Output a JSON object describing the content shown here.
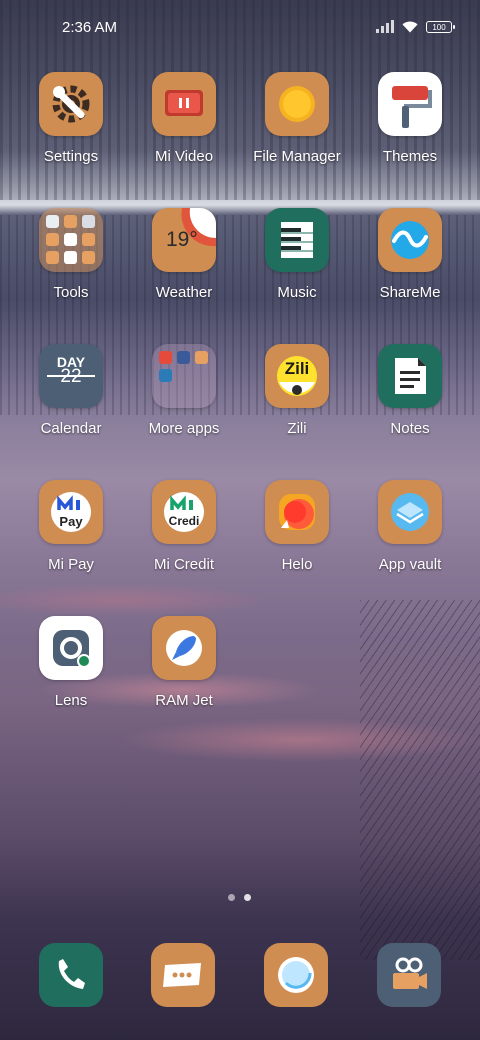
{
  "status_bar": {
    "time": "2:36 AM",
    "battery": "100",
    "icons": [
      "signal-icon",
      "wifi-icon",
      "battery-icon"
    ]
  },
  "apps": [
    {
      "label": "Settings",
      "icon": "settings-icon"
    },
    {
      "label": "Mi Video",
      "icon": "mi-video-icon"
    },
    {
      "label": "File Manager",
      "icon": "file-manager-icon"
    },
    {
      "label": "Themes",
      "icon": "themes-icon"
    },
    {
      "label": "Tools",
      "icon": "tools-folder-icon"
    },
    {
      "label": "Weather",
      "icon": "weather-icon",
      "temperature": "19°"
    },
    {
      "label": "Music",
      "icon": "music-icon"
    },
    {
      "label": "ShareMe",
      "icon": "shareme-icon"
    },
    {
      "label": "Calendar",
      "icon": "calendar-icon",
      "day_text": "DAY",
      "date": "22"
    },
    {
      "label": "More apps",
      "icon": "more-apps-folder-icon"
    },
    {
      "label": "Zili",
      "icon": "zili-icon",
      "logo_text": "Zili"
    },
    {
      "label": "Notes",
      "icon": "notes-icon"
    },
    {
      "label": "Mi Pay",
      "icon": "mi-pay-icon",
      "logo_text": "Pay"
    },
    {
      "label": "Mi Credit",
      "icon": "mi-credit-icon",
      "logo_text": "Credi"
    },
    {
      "label": "Helo",
      "icon": "helo-icon"
    },
    {
      "label": "App vault",
      "icon": "app-vault-icon"
    },
    {
      "label": "Lens",
      "icon": "lens-icon"
    },
    {
      "label": "RAM Jet",
      "icon": "ram-jet-icon"
    }
  ],
  "page_indicator": {
    "pages": 2,
    "current": 1
  },
  "dock": [
    {
      "icon": "phone-icon"
    },
    {
      "icon": "messaging-icon"
    },
    {
      "icon": "browser-icon"
    },
    {
      "icon": "camera-icon"
    }
  ],
  "colors": {
    "tile_orange": "#d08d52",
    "tile_teal": "#1f6e5e",
    "tile_slate": "#4d5f74",
    "tile_white": "#ffffff",
    "label_text": "#ffffff"
  }
}
